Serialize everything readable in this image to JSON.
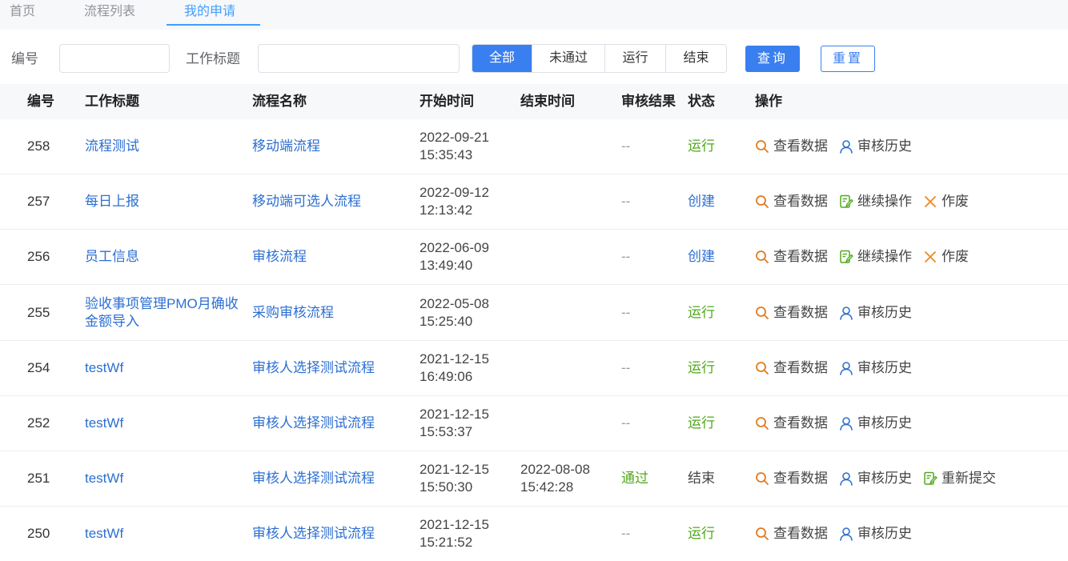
{
  "tabs": [
    {
      "label": "首页"
    },
    {
      "label": "流程列表"
    },
    {
      "label": "我的申请"
    }
  ],
  "filter": {
    "id_label": "编号",
    "title_label": "工作标题",
    "id_value": "",
    "title_value": "",
    "segments": [
      "全部",
      "未通过",
      "运行",
      "结束"
    ],
    "selected_segment": "全部",
    "query_label": "查询",
    "reset_label": "重置"
  },
  "table": {
    "headers": {
      "id": "编号",
      "title": "工作标题",
      "flow": "流程名称",
      "start": "开始时间",
      "end": "结束时间",
      "result": "审核结果",
      "status": "状态",
      "ops": "操作"
    },
    "rows": [
      {
        "id": "258",
        "title": "流程测试",
        "flow": "移动端流程",
        "start_date": "2022-09-21",
        "start_time": "15:35:43",
        "end_date": "",
        "end_time": "",
        "result": "--",
        "status": "运行",
        "status_kind": "run",
        "ops": [
          {
            "label": "查看数据",
            "icon": "search-icon"
          },
          {
            "label": "审核历史",
            "icon": "user-icon"
          }
        ]
      },
      {
        "id": "257",
        "title": "每日上报",
        "flow": "移动端可选人流程",
        "start_date": "2022-09-12",
        "start_time": "12:13:42",
        "end_date": "",
        "end_time": "",
        "result": "--",
        "status": "创建",
        "status_kind": "create",
        "ops": [
          {
            "label": "查看数据",
            "icon": "search-icon"
          },
          {
            "label": "继续操作",
            "icon": "edit-icon"
          },
          {
            "label": "作废",
            "icon": "close-icon"
          }
        ]
      },
      {
        "id": "256",
        "title": "员工信息",
        "flow": "审核流程",
        "start_date": "2022-06-09",
        "start_time": "13:49:40",
        "end_date": "",
        "end_time": "",
        "result": "--",
        "status": "创建",
        "status_kind": "create",
        "ops": [
          {
            "label": "查看数据",
            "icon": "search-icon"
          },
          {
            "label": "继续操作",
            "icon": "edit-icon"
          },
          {
            "label": "作废",
            "icon": "close-icon"
          }
        ]
      },
      {
        "id": "255",
        "title": "验收事项管理PMO月确收金额导入",
        "flow": "采购审核流程",
        "start_date": "2022-05-08",
        "start_time": "15:25:40",
        "end_date": "",
        "end_time": "",
        "result": "--",
        "status": "运行",
        "status_kind": "run",
        "ops": [
          {
            "label": "查看数据",
            "icon": "search-icon"
          },
          {
            "label": "审核历史",
            "icon": "user-icon"
          }
        ]
      },
      {
        "id": "254",
        "title": "testWf",
        "flow": "审核人选择测试流程",
        "start_date": "2021-12-15",
        "start_time": "16:49:06",
        "end_date": "",
        "end_time": "",
        "result": "--",
        "status": "运行",
        "status_kind": "run",
        "ops": [
          {
            "label": "查看数据",
            "icon": "search-icon"
          },
          {
            "label": "审核历史",
            "icon": "user-icon"
          }
        ]
      },
      {
        "id": "252",
        "title": "testWf",
        "flow": "审核人选择测试流程",
        "start_date": "2021-12-15",
        "start_time": "15:53:37",
        "end_date": "",
        "end_time": "",
        "result": "--",
        "status": "运行",
        "status_kind": "run",
        "ops": [
          {
            "label": "查看数据",
            "icon": "search-icon"
          },
          {
            "label": "审核历史",
            "icon": "user-icon"
          }
        ]
      },
      {
        "id": "251",
        "title": "testWf",
        "flow": "审核人选择测试流程",
        "start_date": "2021-12-15",
        "start_time": "15:50:30",
        "end_date": "2022-08-08",
        "end_time": "15:42:28",
        "result": "通过",
        "status": "结束",
        "status_kind": "end",
        "ops": [
          {
            "label": "查看数据",
            "icon": "search-icon"
          },
          {
            "label": "审核历史",
            "icon": "user-icon"
          },
          {
            "label": "重新提交",
            "icon": "edit-icon"
          }
        ]
      },
      {
        "id": "250",
        "title": "testWf",
        "flow": "审核人选择测试流程",
        "start_date": "2021-12-15",
        "start_time": "15:21:52",
        "end_date": "",
        "end_time": "",
        "result": "--",
        "status": "运行",
        "status_kind": "run",
        "ops": [
          {
            "label": "查看数据",
            "icon": "search-icon"
          },
          {
            "label": "审核历史",
            "icon": "user-icon"
          }
        ]
      }
    ]
  },
  "colors": {
    "primary": "#3a7ff0",
    "link": "#2c6fd1",
    "success": "#52a81e",
    "search_icon": "#e07b1f",
    "user_icon": "#2c6fd1",
    "edit_icon": "#52a81e",
    "close_icon": "#f08a24"
  }
}
